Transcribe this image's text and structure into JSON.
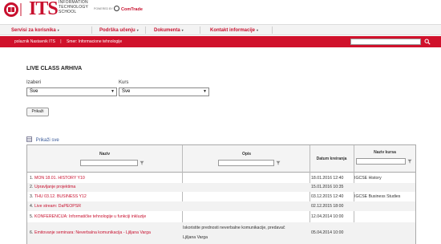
{
  "header": {
    "logo_text": "ITS",
    "logo_sub_lines": [
      "INFORMATION",
      "TECHNOLOGY",
      "SCHOOL"
    ],
    "powered_by": "POWERED BY",
    "partner": "ComTrade",
    "brand_color": "#c8102e"
  },
  "nav": {
    "items": [
      {
        "label": "Servisi za korisnika",
        "caret": "▾"
      },
      {
        "label": "Podrška učenju",
        "caret": "▾"
      },
      {
        "label": "Dokumenta",
        "caret": "▾"
      },
      {
        "label": "Kontakt informacije",
        "caret": "▾"
      }
    ]
  },
  "breadcrumb": {
    "role": "polaznik",
    "user": "Nastavnik ITS",
    "separator": "|",
    "smer": "Smer: Informacione tehnologije"
  },
  "search": {
    "placeholder": ""
  },
  "page": {
    "title": "LIVE CLASS ARHIVA",
    "izaberi_label": "Izaberi",
    "kurs_label": "Kurs",
    "izaberi_value": "Sve",
    "kurs_value": "Sve",
    "submit_label": "Prikaži",
    "show_all_label": "Prikaži sve"
  },
  "table": {
    "headers": {
      "naziv": "Naziv",
      "opis": "Opis",
      "datum": "Datum kreiranja",
      "kurs": "Naziv kursa"
    },
    "rows": [
      {
        "num": "1.",
        "naziv": "MON 18.01. HISTORY Y10",
        "opis": "",
        "opis2": "",
        "datum": "18.01.2016 12:40",
        "kurs": "IGCSE History"
      },
      {
        "num": "2.",
        "naziv": "Upravljanje projektima",
        "opis": "",
        "opis2": "",
        "datum": "15.01.2016 10:35",
        "kurs": ""
      },
      {
        "num": "3.",
        "naziv": "THU 03.12. BUSINESS Y12",
        "opis": "",
        "opis2": "",
        "datum": "03.12.2015 12:40",
        "kurs": "IGCSE Business Studies"
      },
      {
        "num": "4.",
        "naziv": "Live stream: DaPEOPSR",
        "opis": "",
        "opis2": "",
        "datum": "02.12.2015 18:00",
        "kurs": ""
      },
      {
        "num": "5.",
        "naziv": "KONFERENCIJA: Informatičke tehnologije u funkciji inkluzije",
        "opis": "",
        "opis2": "",
        "datum": "12.04.2014 10:00",
        "kurs": ""
      },
      {
        "num": "6.",
        "naziv": "Emitovanje seminara: Neverbalna komunikacija - Ljiljana Varga",
        "opis": "Iskoristite prednosti neverbalne komunikacije, predavač",
        "opis2": "Ljiljana Varga",
        "datum": "05.04.2014 10:00",
        "kurs": ""
      }
    ]
  }
}
